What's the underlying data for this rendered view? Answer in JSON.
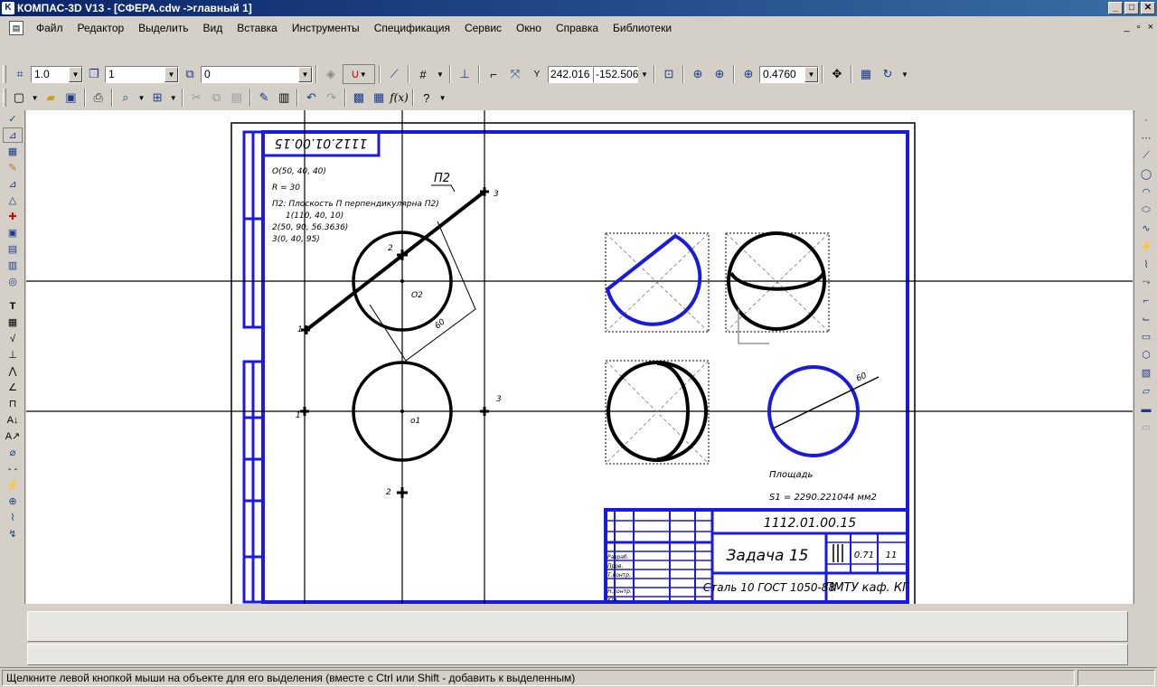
{
  "window": {
    "title": "КОМПАС-3D V13 - [СФЕРА.cdw ->главный 1]",
    "app_icon": "kompas-icon",
    "controls": [
      "_",
      "□",
      "✕"
    ]
  },
  "menu": {
    "items": [
      "Файл",
      "Редактор",
      "Выделить",
      "Вид",
      "Вставка",
      "Инструменты",
      "Спецификация",
      "Сервис",
      "Окно",
      "Справка",
      "Библиотеки"
    ],
    "mdi_controls": [
      "_",
      "▫",
      "×"
    ]
  },
  "toolbar_current": {
    "step": "1.0",
    "layer": "1",
    "style": "0",
    "x": "242.016",
    "y": "-152.506",
    "zoom": "0.4760"
  },
  "drawing": {
    "designation_rotated": "1112.01.00.15",
    "params": [
      "O(50, 40, 40)",
      "R = 30",
      "П2: Плоскость П перпендикулярна П2)",
      "1(110, 40, 10)",
      "2(50, 90, 56.3636)",
      "3(0, 40, 95)"
    ],
    "plane_label": "П2",
    "pt1": "1",
    "pt2": "2",
    "pt3": "3",
    "o2": "O2",
    "o1": "o1",
    "dim_top": "60",
    "dim_right": "60",
    "area_title": "Площадь",
    "area_value": "S1     = 2290.221044  мм2",
    "title_block": {
      "designation": "1112.01.00.15",
      "name": "Задача 15",
      "material": "Сталь 10  ГОСТ 1050-88",
      "org": "ПМТУ каф. КГ",
      "mass": "0.71",
      "scale": "11",
      "small_labels": [
        "Разраб.",
        "Пров.",
        "Т.контр.",
        "Н.контр.",
        "Утв."
      ]
    }
  },
  "statusbar": {
    "hint": "Щелкните левой кнопкой мыши на объекте для его выделения (вместе с Ctrl или Shift - добавить к выделенным)"
  },
  "colors": {
    "accent_blue": "#1a1adf",
    "line_black": "#000000"
  }
}
